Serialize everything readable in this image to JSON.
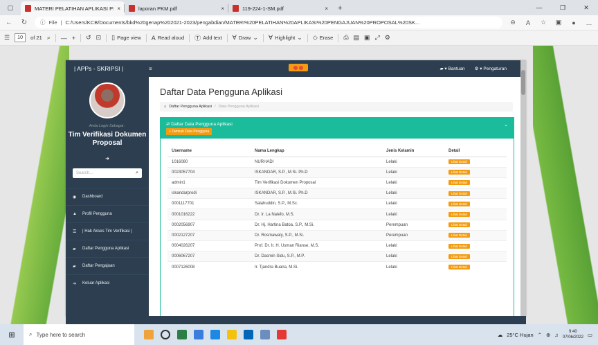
{
  "browser": {
    "tabs": [
      {
        "title": "MATERI PELATIHAN APLIKASI PE",
        "active": true
      },
      {
        "title": "laporan PKM.pdf",
        "active": false
      },
      {
        "title": "119-224-1-SM.pdf",
        "active": false
      }
    ],
    "close_glyph": "×",
    "newtab_glyph": "+",
    "url_prefix": "File",
    "url": "C:/Users/KCB/Documents/bkd%20genap%202021-2023/pengabdian/MATERI%20PELATIHAN%20APLIKASI%20PENGAJUAN%20PROPOSAL%20SK..."
  },
  "pdf_toolbar": {
    "page_current": "10",
    "page_total": "of 21",
    "page_view": "Page view",
    "read_aloud": "Read aloud",
    "add_text": "Add text",
    "draw": "Draw",
    "highlight": "Highlight",
    "erase": "Erase"
  },
  "app": {
    "brand": "| APPs - SKRIPSI |",
    "top_menu": [
      "Bantuan",
      "Pengaturan"
    ],
    "login_as": "Anda Login Sebagai :",
    "role": "Tim Verifikasi Dokumen Proposal",
    "search_placeholder": "Search...",
    "menu": [
      "Dashboard",
      "Profil Pengguna",
      "| Hak Akses Tim Verifikasi |",
      "Daftar Pengguna Aplikasi",
      "Daftar Pengajuan",
      "Keluar Aplikasi"
    ],
    "page_title": "Daftar Data Pengguna Aplikasi",
    "breadcrumb": [
      "Daftar Pengguna Aplikasi",
      "/",
      "Data Pengguna Aplikasi"
    ],
    "panel_title": "Daftar Data Pengguna Aplikasi",
    "add_button": "+ Tambah Data Pengguna",
    "table": {
      "headers": [
        "Username",
        "Nama Lengkap",
        "Jenis Kelamin",
        "Detail"
      ],
      "detail_label": "Lihat Detail",
      "rows": [
        [
          "1016080",
          "NURHADI",
          "Lelaki"
        ],
        [
          "0023057704",
          "ISKANDAR, S.P., M.Si. Ph.D",
          "Lelaki"
        ],
        [
          "admin1",
          "Tim Verifikasi Dokumen Proposal",
          "Lelaki"
        ],
        [
          "iskandarprodi",
          "ISKANDAR, S.P., M.Si. Ph.D",
          "Lelaki"
        ],
        [
          "0001117701",
          "Salahuddin, S.P., M.Sc.",
          "Lelaki"
        ],
        [
          "0001016222",
          "Dr. Ir. La Nalefo, M.S.",
          "Lelaki"
        ],
        [
          "0002056907",
          "Dr. Hj. Hartina Batoa, S.P., M.Si.",
          "Perempuan"
        ],
        [
          "0002127207",
          "Dr. Rosmawaty, S.P., M.Si.",
          "Perempuan"
        ],
        [
          "0004026207",
          "Prof. Dr. Ir. H. Usman Rianse, M.S.",
          "Lelaki"
        ],
        [
          "0006067207",
          "Dr. Dasmin Sidu, S.P., M.P.",
          "Lelaki"
        ],
        [
          "0007126008",
          "Ir. Tjandra Buana, M.Si.",
          "Lelaki"
        ]
      ]
    }
  },
  "taskbar": {
    "search_placeholder": "Type here to search",
    "weather": "25°C Hujan",
    "time": "9:40",
    "date": "07/06/2022",
    "icon_colors": [
      "#f0a33a",
      "#333333",
      "#2d7d46",
      "#3b7ddd",
      "#1e88e5",
      "#f4c20d",
      "#0067b8",
      "#6c8ebf",
      "#e53935"
    ]
  },
  "colors": {
    "app_dark": "#2c3e50",
    "panel_accent": "#1abc9c",
    "button_orange": "#f39c12"
  }
}
